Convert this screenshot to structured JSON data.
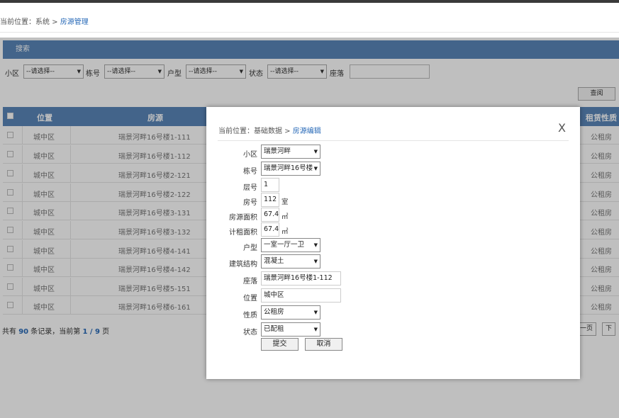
{
  "header": {
    "breadcrumb_prefix": "当前位置：系统 > ",
    "breadcrumb_current": "房源管理"
  },
  "search": {
    "title": "搜索",
    "filters": [
      {
        "label": "小区",
        "value": "--请选择--"
      },
      {
        "label": "栋号",
        "value": "--请选择--"
      },
      {
        "label": "户型",
        "value": "--请选择--"
      },
      {
        "label": "状态",
        "value": "--请选择--"
      }
    ],
    "address_label": "座落",
    "query_label": "查阅"
  },
  "table": {
    "headers": {
      "location": "位置",
      "house": "房源",
      "property": "租赁性质"
    },
    "rows": [
      {
        "location": "城中区",
        "house": "瑞景河畔16号楼1-111",
        "property": "公租房"
      },
      {
        "location": "城中区",
        "house": "瑞景河畔16号楼1-112",
        "property": "公租房"
      },
      {
        "location": "城中区",
        "house": "瑞景河畔16号楼2-121",
        "property": "公租房"
      },
      {
        "location": "城中区",
        "house": "瑞景河畔16号楼2-122",
        "property": "公租房"
      },
      {
        "location": "城中区",
        "house": "瑞景河畔16号楼3-131",
        "property": "公租房"
      },
      {
        "location": "城中区",
        "house": "瑞景河畔16号楼3-132",
        "property": "公租房"
      },
      {
        "location": "城中区",
        "house": "瑞景河畔16号楼4-141",
        "property": "公租房"
      },
      {
        "location": "城中区",
        "house": "瑞景河畔16号楼4-142",
        "property": "公租房"
      },
      {
        "location": "城中区",
        "house": "瑞景河畔16号楼5-151",
        "property": "公租房"
      },
      {
        "location": "城中区",
        "house": "瑞景河畔16号楼6-161",
        "property": "公租房"
      }
    ]
  },
  "pager": {
    "p1": "共有 ",
    "total": "90",
    "p2": " 条记录，当前第 ",
    "page": "1 / 9",
    "p3": " 页",
    "prev": "一页",
    "next": "下"
  },
  "modal": {
    "breadcrumb_prefix": "当前位置：基础数据 > ",
    "breadcrumb_current": "房源编辑",
    "close": "X",
    "fields": {
      "community": {
        "label": "小区",
        "value": "瑞景河畔"
      },
      "building": {
        "label": "栋号",
        "value": "瑞景河畔16号楼"
      },
      "floor": {
        "label": "层号",
        "value": "1"
      },
      "room": {
        "label": "房号",
        "value": "112",
        "unit": "室"
      },
      "area": {
        "label": "房源面积",
        "value": "67.4",
        "unit": "㎡"
      },
      "rent_area": {
        "label": "计租面积",
        "value": "67.4",
        "unit": "㎡"
      },
      "layout": {
        "label": "户型",
        "value": "一室一厅一卫"
      },
      "structure": {
        "label": "建筑结构",
        "value": "混凝土"
      },
      "address": {
        "label": "座落",
        "value": "瑞景河畔16号楼1-112"
      },
      "location": {
        "label": "位置",
        "value": "城中区"
      },
      "nature": {
        "label": "性质",
        "value": "公租房"
      },
      "status": {
        "label": "状态",
        "value": "已配租"
      }
    },
    "submit": "提交",
    "cancel": "取消"
  },
  "icons": {
    "dropdown": "▼"
  }
}
